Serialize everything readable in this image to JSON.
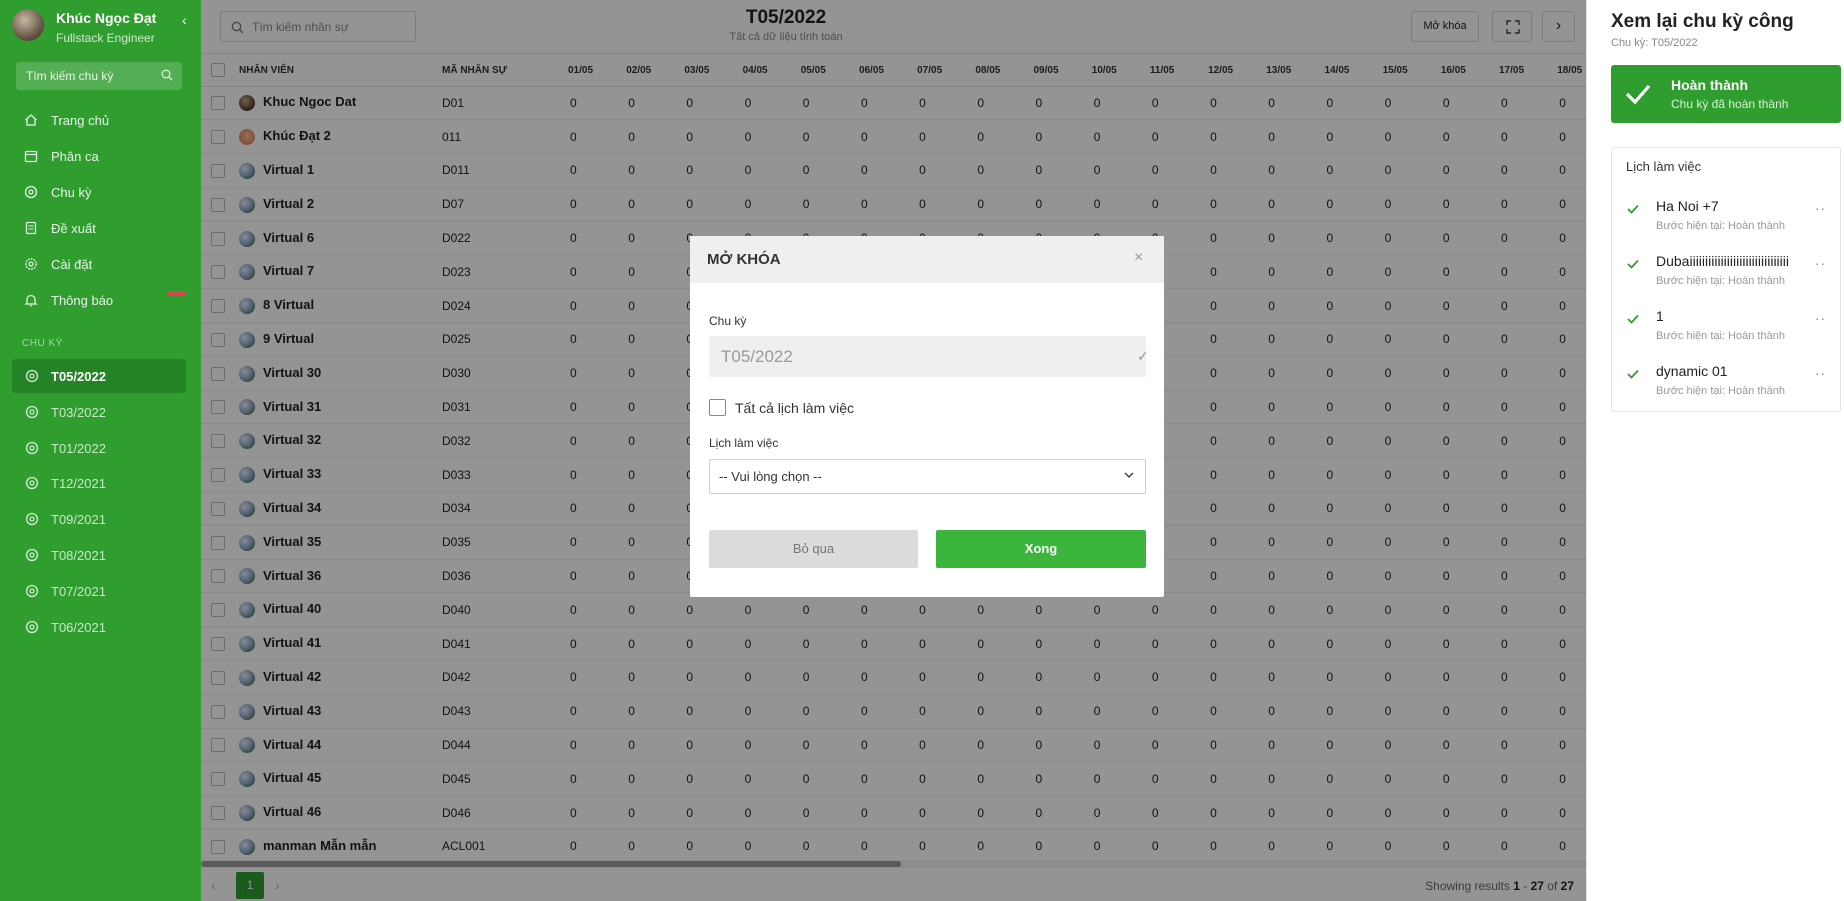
{
  "user": {
    "name": "Khúc Ngọc Đạt",
    "role": "Fullstack Engineer"
  },
  "sidebar": {
    "search_placeholder": "Tìm kiếm chu kỳ",
    "nav": [
      {
        "label": "Trang chủ",
        "icon": "home-icon"
      },
      {
        "label": "Phân ca",
        "icon": "calendar-icon"
      },
      {
        "label": "Chu kỳ",
        "icon": "cycle-icon"
      },
      {
        "label": "Đề xuất",
        "icon": "document-icon"
      },
      {
        "label": "Cài đặt",
        "icon": "gear-icon"
      },
      {
        "label": "Thông báo",
        "icon": "bell-icon"
      }
    ],
    "section_title": "CHU KỲ",
    "cycles": [
      "T05/2022",
      "T03/2022",
      "T01/2022",
      "T12/2021",
      "T09/2021",
      "T08/2021",
      "T07/2021",
      "T06/2021"
    ],
    "active_cycle": "T05/2022"
  },
  "topbar": {
    "search_placeholder": "Tìm kiếm nhân sự",
    "title": "T05/2022",
    "subtitle": "Tất cả dữ liệu tính toán",
    "unlock_label": "Mở khóa",
    "next_label": "›"
  },
  "table": {
    "headers": {
      "employee": "NHÂN VIÊN",
      "code": "MÃ NHÂN SỰ"
    },
    "days": [
      "01/05",
      "02/05",
      "03/05",
      "04/05",
      "05/05",
      "06/05",
      "07/05",
      "08/05",
      "09/05",
      "10/05",
      "11/05",
      "12/05",
      "13/05",
      "14/05",
      "15/05",
      "16/05",
      "17/05",
      "18/05"
    ],
    "rows": [
      {
        "name": "Khuc Ngoc Dat",
        "code": "D01",
        "avatar": "photo"
      },
      {
        "name": "Khúc Đạt 2",
        "code": "011",
        "avatar": "orange"
      },
      {
        "name": "Virtual 1",
        "code": "D011",
        "avatar": "globe"
      },
      {
        "name": "Virtual 2",
        "code": "D07",
        "avatar": "globe"
      },
      {
        "name": "Virtual 6",
        "code": "D022",
        "avatar": "globe"
      },
      {
        "name": "Virtual 7",
        "code": "D023",
        "avatar": "globe"
      },
      {
        "name": "8 Virtual",
        "code": "D024",
        "avatar": "globe"
      },
      {
        "name": "9 Virtual",
        "code": "D025",
        "avatar": "globe"
      },
      {
        "name": "Virtual 30",
        "code": "D030",
        "avatar": "globe"
      },
      {
        "name": "Virtual 31",
        "code": "D031",
        "avatar": "globe"
      },
      {
        "name": "Virtual 32",
        "code": "D032",
        "avatar": "globe"
      },
      {
        "name": "Virtual 33",
        "code": "D033",
        "avatar": "globe"
      },
      {
        "name": "Virtual 34",
        "code": "D034",
        "avatar": "globe"
      },
      {
        "name": "Virtual 35",
        "code": "D035",
        "avatar": "globe"
      },
      {
        "name": "Virtual 36",
        "code": "D036",
        "avatar": "globe"
      },
      {
        "name": "Virtual 40",
        "code": "D040",
        "avatar": "globe"
      },
      {
        "name": "Virtual 41",
        "code": "D041",
        "avatar": "globe"
      },
      {
        "name": "Virtual 42",
        "code": "D042",
        "avatar": "globe"
      },
      {
        "name": "Virtual 43",
        "code": "D043",
        "avatar": "globe"
      },
      {
        "name": "Virtual 44",
        "code": "D044",
        "avatar": "globe"
      },
      {
        "name": "Virtual 45",
        "code": "D045",
        "avatar": "globe"
      },
      {
        "name": "Virtual 46",
        "code": "D046",
        "avatar": "globe"
      },
      {
        "name": "manman Mẫn mẫn",
        "code": "ACL001",
        "avatar": "globe"
      }
    ],
    "cell_value": "0"
  },
  "pagination": {
    "current": "1",
    "prev": "‹",
    "next": "›",
    "info_prefix": "Showing results",
    "from": "1",
    "to": "27",
    "of_word": "of",
    "total": "27"
  },
  "right_panel": {
    "title": "Xem lại chu kỳ công",
    "subtitle": "Chu kỳ: T05/2022",
    "status_title": "Hoàn thành",
    "status_sub": "Chu kỳ đã hoàn thành",
    "schedule_title": "Lịch làm việc",
    "schedules": [
      {
        "name": "Ha Noi +7",
        "step": "Bước hiện tại: Hoàn thành"
      },
      {
        "name": "Dubaiiiiiiiiiiiiiiiiiiiiiiiiiiiiiiii",
        "step": "Bước hiện tại: Hoàn thành"
      },
      {
        "name": "1",
        "step": "Bước hiện tại: Hoàn thành"
      },
      {
        "name": "dynamic 01",
        "step": "Bước hiện tại: Hoàn thành"
      }
    ]
  },
  "modal": {
    "title": "MỞ KHÓA",
    "close": "×",
    "period_label": "Chu kỳ",
    "period_value": "T05/2022",
    "period_check": "✓",
    "all_schedules_label": "Tất cả lịch làm việc",
    "schedule_label": "Lịch làm việc",
    "schedule_placeholder": "-- Vui lòng chọn --",
    "skip_label": "Bỏ qua",
    "done_label": "Xong"
  },
  "colors": {
    "brand": "#2f9e2f",
    "primary_button": "#3cb53c",
    "badge": "#e0444c"
  }
}
